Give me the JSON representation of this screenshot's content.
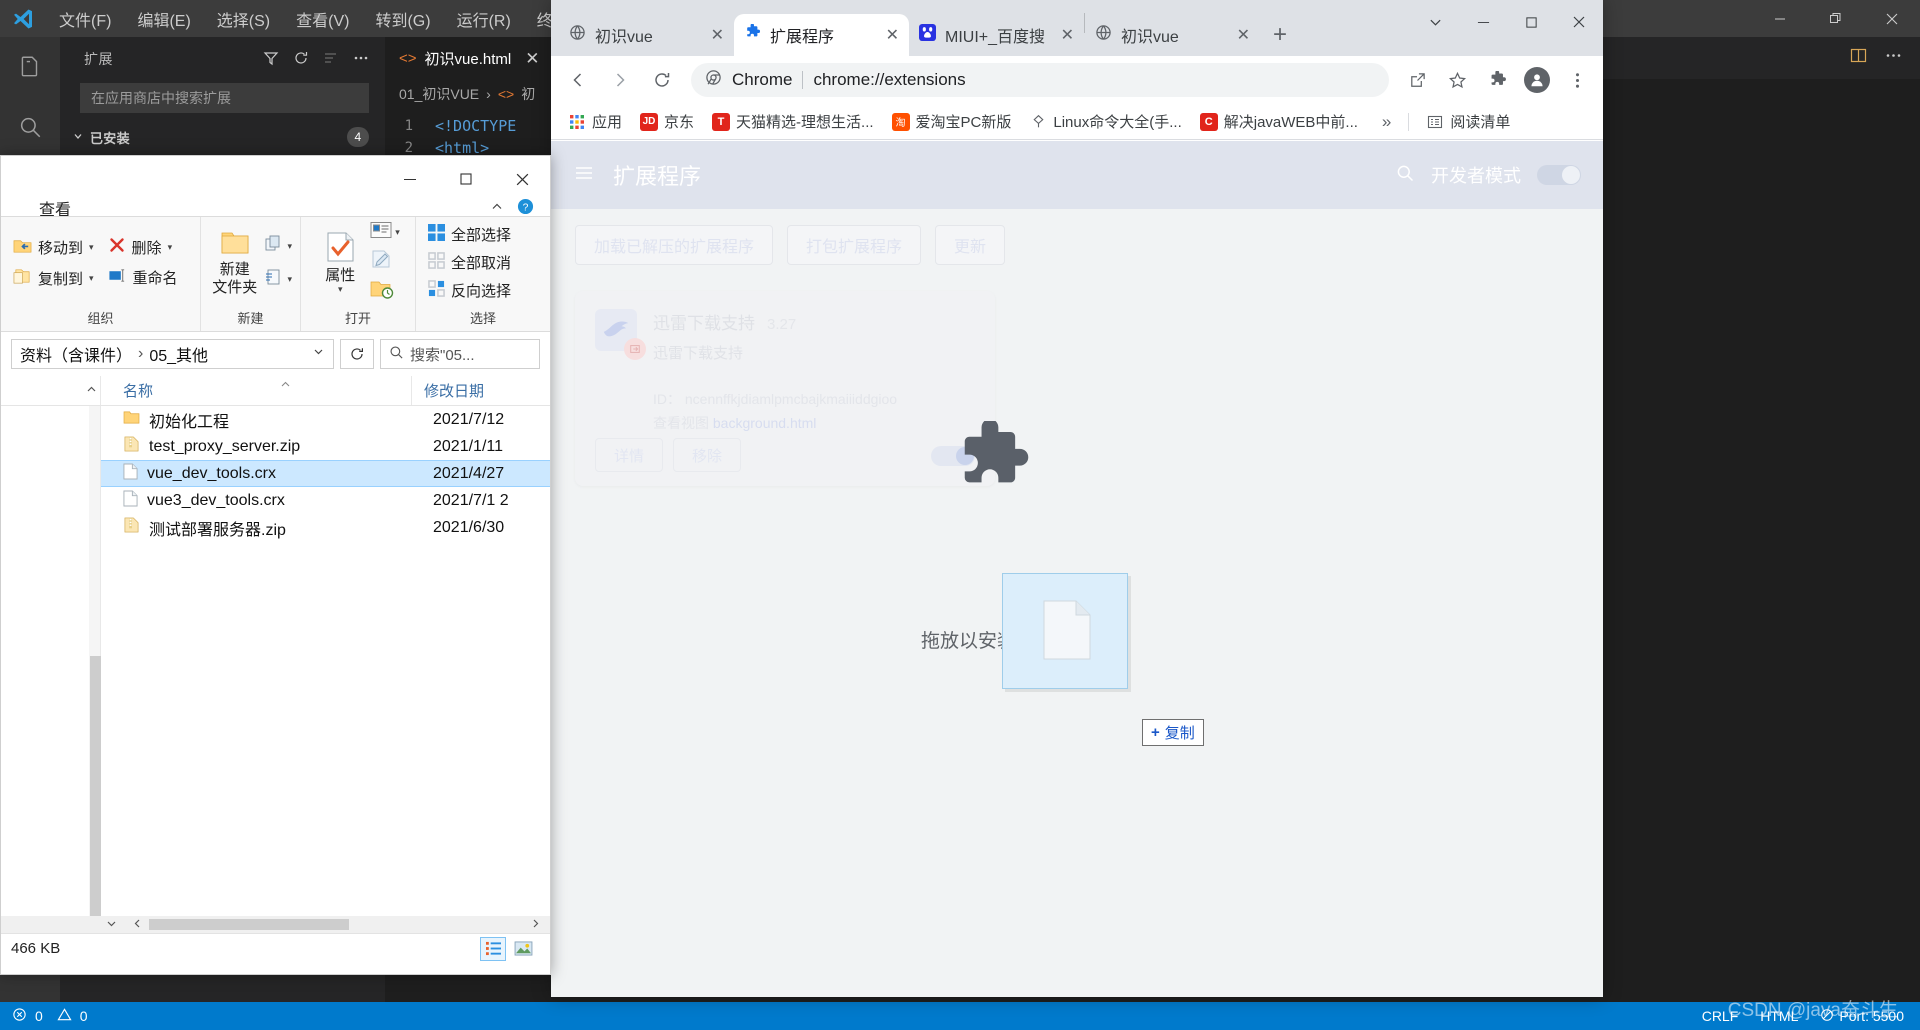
{
  "vscode": {
    "menu": [
      "文件(F)",
      "编辑(E)",
      "选择(S)",
      "查看(V)",
      "转到(G)",
      "运行(R)",
      "终端(T)"
    ],
    "sidebar": {
      "title": "扩展",
      "search_placeholder": "在应用商店中搜索扩展",
      "section_label": "已安装",
      "section_count": "4"
    },
    "editor": {
      "tab_label": "初识vue.html",
      "breadcrumb": [
        "01_初识VUE",
        "初"
      ],
      "lines": [
        {
          "n": "1",
          "text": "<!DOCTYPE"
        },
        {
          "n": "2",
          "text": "<html>"
        }
      ]
    },
    "statusbar": {
      "errors": "0",
      "warnings": "0",
      "eol": "CRLF",
      "language": "HTML",
      "port": "Port: 5500"
    },
    "watermark": "CSDN @java奋斗生"
  },
  "explorer": {
    "ribbon_tab": "查看",
    "groups": [
      {
        "title": "组织",
        "items": [
          "移动到",
          "删除",
          "复制到",
          "重命名"
        ]
      },
      {
        "title": "新建",
        "big_label": "新建\n文件夹"
      },
      {
        "title": "打开",
        "big_label": "属性"
      },
      {
        "title": "选择",
        "items": [
          "全部选择",
          "全部取消",
          "反向选择"
        ]
      }
    ],
    "org_items": [
      "移动到",
      "删除",
      "复制到",
      "重命名"
    ],
    "new_label_line1": "新建",
    "new_label_line2": "文件夹",
    "open_label": "属性",
    "select_items": [
      "全部选择",
      "全部取消",
      "反向选择"
    ],
    "group_titles": [
      "组织",
      "新建",
      "打开",
      "选择"
    ],
    "address": {
      "crumb_prev": "资料（含课件）",
      "crumb_current": "05_其他",
      "search_placeholder": "搜索\"05..."
    },
    "columns": [
      "名称",
      "修改日期"
    ],
    "rows": [
      {
        "icon": "folder",
        "name": "初始化工程",
        "date": "2021/7/12",
        "selected": false
      },
      {
        "icon": "zip",
        "name": "test_proxy_server.zip",
        "date": "2021/1/11",
        "selected": false
      },
      {
        "icon": "file",
        "name": "vue_dev_tools.crx",
        "date": "2021/4/27",
        "selected": true
      },
      {
        "icon": "file",
        "name": "vue3_dev_tools.crx",
        "date": "2021/7/1 2",
        "selected": false
      },
      {
        "icon": "zip",
        "name": "测试部署服务器.zip",
        "date": "2021/6/30",
        "selected": false
      }
    ],
    "status_size": "466 KB"
  },
  "chrome": {
    "tabs": [
      {
        "label": "初识vue",
        "icon": "globe-icon",
        "active": false
      },
      {
        "label": "扩展程序",
        "icon": "puzzle-icon",
        "active": true
      },
      {
        "label": "MIUI+_百度搜",
        "icon": "baidu-icon",
        "active": false
      },
      {
        "label": "初识vue",
        "icon": "globe-icon",
        "active": false
      }
    ],
    "omnibox": {
      "scheme_label": "Chrome",
      "url": "chrome://extensions"
    },
    "bookmarks": [
      {
        "label": "应用",
        "icon": "apps-grid",
        "color": "#4285f4"
      },
      {
        "label": "京东",
        "icon": "JD",
        "color": "#e1251b"
      },
      {
        "label": "天猫精选-理想生活...",
        "icon": "T",
        "color": "#e1251b"
      },
      {
        "label": "爱淘宝PC新版",
        "icon": "淘",
        "color": "#ff5000"
      },
      {
        "label": "Linux命令大全(手...",
        "icon": "linux",
        "color": "#5f6368"
      },
      {
        "label": "解决javaWEB中前...",
        "icon": "C",
        "color": "#e1251b"
      }
    ],
    "bookmarks_overflow": "»",
    "reading_list": "阅读清单"
  },
  "extensions_page": {
    "header_title": "扩展程序",
    "dev_mode_label": "开发者模式",
    "action_buttons": [
      "加载已解压的扩展程序",
      "打包扩展程序",
      "更新"
    ],
    "card": {
      "name": "迅雷下载支持",
      "version": "3.27",
      "description": "迅雷下载支持",
      "id_label": "ID：",
      "id_value": "ncennffkjdiamlpmcbajkmaiiiddgioo",
      "views_label": "查看视图",
      "views_value": "background.html",
      "details_btn": "详情",
      "remove_btn": "移除"
    },
    "drop_text": "拖放以安装",
    "drag_badge": "复制"
  }
}
